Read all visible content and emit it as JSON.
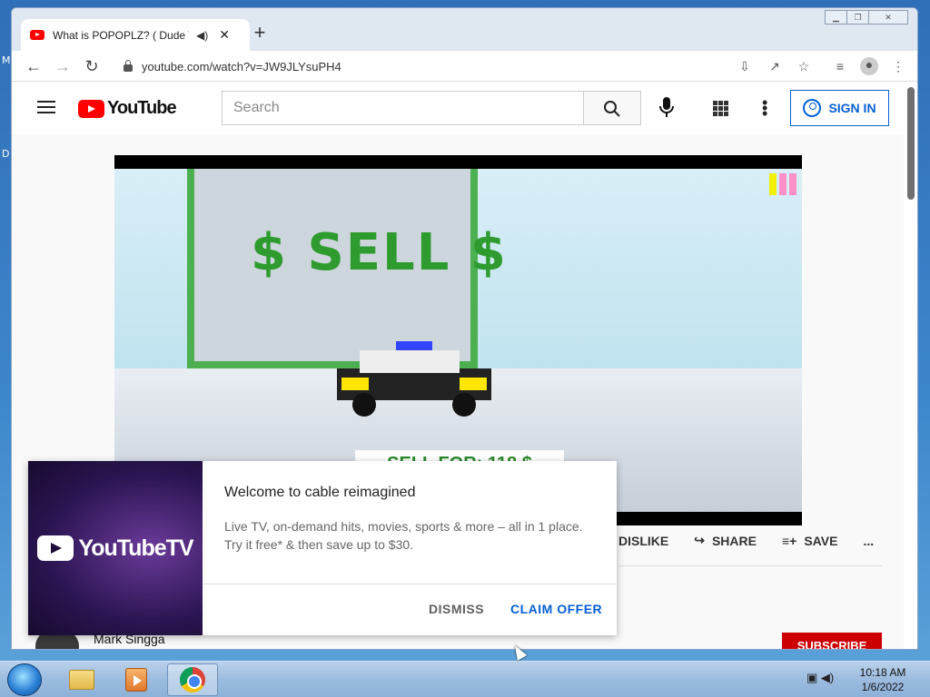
{
  "desktop": {
    "edge_labels": [
      "M",
      "D"
    ]
  },
  "browser": {
    "tab": {
      "title": "What is POPOPLZ? ( Dude Th",
      "audio_icon": "speaker-icon"
    },
    "new_tab": "+",
    "url": "youtube.com/watch?v=JW9JLYsuPH4"
  },
  "youtube": {
    "logo": "YouTube",
    "search_placeholder": "Search",
    "sign_in": "SIGN IN",
    "actions": {
      "dislike": "DISLIKE",
      "share": "SHARE",
      "save": "SAVE",
      "more": "..."
    },
    "channel": "Mark Singga",
    "subscribe": "SUBSCRIBE",
    "video_text": {
      "sign": "$ SELL $",
      "price": "SELL FOR: 118 $"
    }
  },
  "popup": {
    "brand": "YouTubeTV",
    "title": "Welcome to cable reimagined",
    "body_line1": "Live TV, on-demand hits, movies, sports & more – all in 1 place.",
    "body_line2": "Try it free* & then save up to $30.",
    "dismiss": "DISMISS",
    "claim": "CLAIM OFFER"
  },
  "taskbar": {
    "time": "10:18 AM",
    "date": "1/6/2022"
  },
  "colors": {
    "youtube_red": "#ff0000",
    "link_blue": "#065fd4",
    "subscribe_red": "#cc0000"
  }
}
